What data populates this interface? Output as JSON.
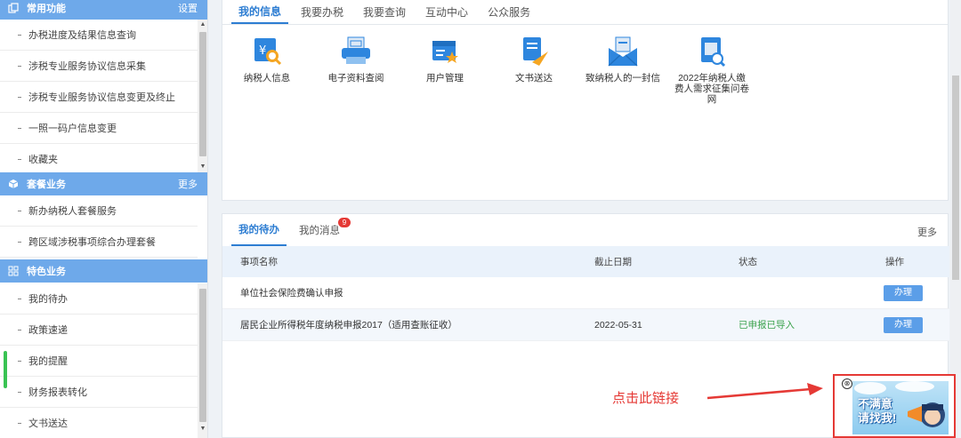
{
  "sidebar": {
    "sections": [
      {
        "title": "常用功能",
        "more": "设置",
        "icon": "copy-icon",
        "items": [
          "办税进度及结果信息查询",
          "涉税专业服务协议信息采集",
          "涉税专业服务协议信息变更及终止",
          "一照一码户信息变更",
          "收藏夹"
        ]
      },
      {
        "title": "套餐业务",
        "more": "更多",
        "icon": "cube-icon",
        "items": [
          "新办纳税人套餐服务",
          "跨区域涉税事项综合办理套餐"
        ]
      },
      {
        "title": "特色业务",
        "more": "",
        "icon": "grid-icon",
        "items": [
          "我的待办",
          "政策速递",
          "我的提醒",
          "财务报表转化",
          "文书送达"
        ]
      }
    ]
  },
  "top_tabs": [
    "我的信息",
    "我要办税",
    "我要查询",
    "互动中心",
    "公众服务"
  ],
  "apps": [
    {
      "label": "纳税人信息",
      "icon": "taxpayer-info-icon"
    },
    {
      "label": "电子资料查阅",
      "icon": "printer-icon"
    },
    {
      "label": "用户管理",
      "icon": "user-manage-icon"
    },
    {
      "label": "文书送达",
      "icon": "paper-plane-icon"
    },
    {
      "label": "致纳税人的一封信",
      "icon": "envelope-icon"
    },
    {
      "label": "2022年纳税人缴费人需求征集问卷网",
      "icon": "survey-icon"
    }
  ],
  "bottom": {
    "tabs": [
      "我的待办",
      "我的消息"
    ],
    "badge": "9",
    "more": "更多",
    "headers": [
      "事项名称",
      "截止日期",
      "状态",
      "操作"
    ],
    "rows": [
      {
        "name": "单位社会保险费确认申报",
        "date": "",
        "status": "",
        "action": "办理"
      },
      {
        "name": "居民企业所得税年度纳税申报2017（适用查账征收）",
        "date": "2022-05-31",
        "status": "已申报已导入",
        "action": "办理"
      }
    ]
  },
  "annotation": {
    "text": "点击此链接",
    "color": "#e53935"
  },
  "ad": {
    "line1": "不满意",
    "line2": "请找我!",
    "close": "⊗"
  },
  "colors": {
    "accent": "#2d7dd2",
    "sidebar_header": "#6ea9ea",
    "button": "#5b9ee8"
  }
}
